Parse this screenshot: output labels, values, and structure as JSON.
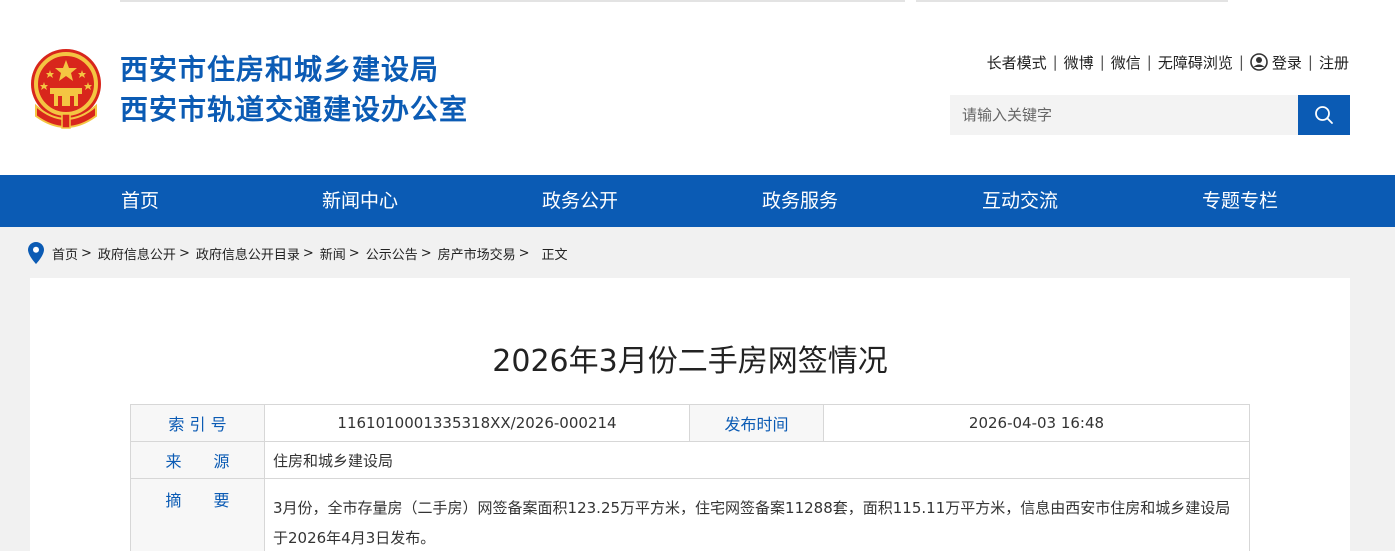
{
  "header": {
    "title_line1": "西安市住房和城乡建设局",
    "title_line2": "西安市轨道交通建设办公室",
    "top_links": [
      "长者模式",
      "微博",
      "微信",
      "无障碍浏览"
    ],
    "login": "登录",
    "register": "注册",
    "search_placeholder": "请输入关键字",
    "brand_color": "#0b5bb4"
  },
  "nav": {
    "items": [
      "首页",
      "新闻中心",
      "政务公开",
      "政务服务",
      "互动交流",
      "专题专栏"
    ]
  },
  "breadcrumb": {
    "items": [
      "首页",
      "政府信息公开",
      "政府信息公开目录",
      "新闻",
      "公示公告",
      "房产市场交易"
    ],
    "current": "正文",
    "separator": ">"
  },
  "article": {
    "title": "2026年3月份二手房网签情况",
    "meta": {
      "index_label": "索 引 号",
      "index_value": "1161010001335318XX/2026-000214",
      "date_label": "发布时间",
      "date_value": "2026-04-03 16:48",
      "source_label": "来　　源",
      "source_value": "住房和城乡建设局",
      "summary_label": "摘　　要",
      "summary_value": "3月份，全市存量房（二手房）网签备案面积123.25万平方米，住宅网签备案11288套，面积115.11万平方米，信息由西安市住房和城乡建设局于2026年4月3日发布。"
    }
  }
}
